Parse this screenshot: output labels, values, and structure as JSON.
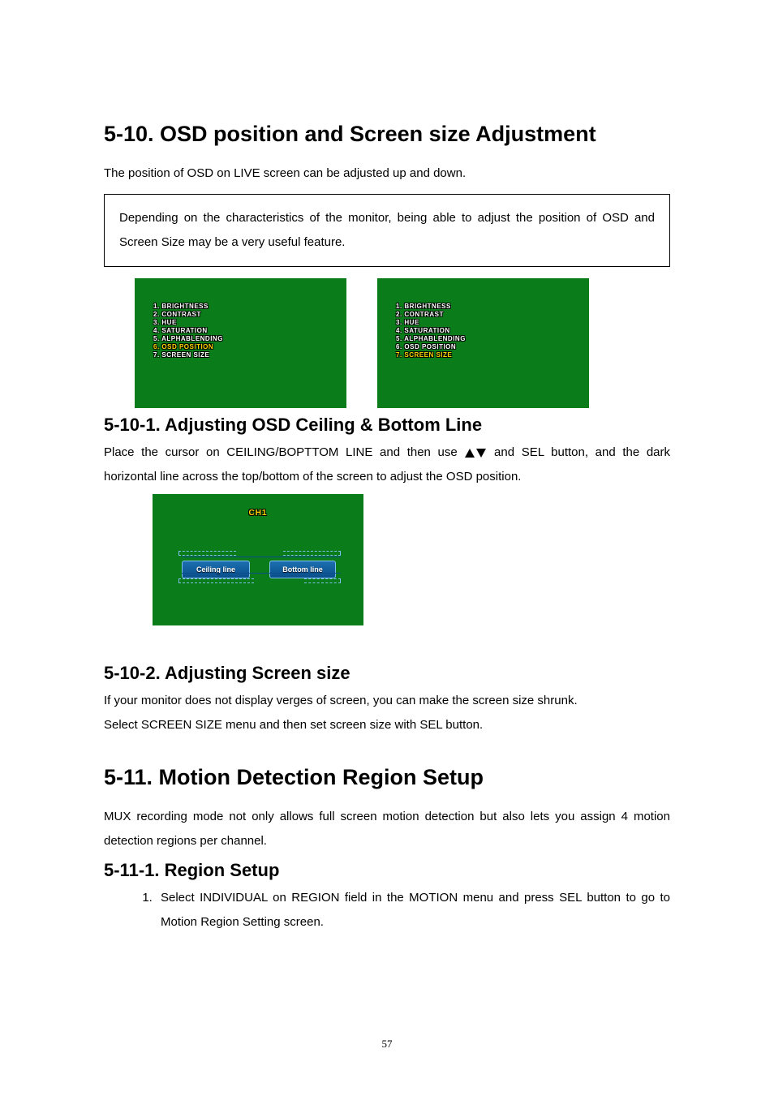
{
  "heading1": "5-10. OSD position and Screen size Adjustment",
  "intro1": "The position of OSD on LIVE screen can be adjusted up and down.",
  "note": "Depending on the characteristics of the monitor, being able to adjust the position of OSD and Screen Size may be a very useful feature.",
  "osd_menu": {
    "items": [
      "1. BRIGHTNESS",
      "2. CONTRAST",
      "3. HUE",
      "4. SATURATION",
      "5. ALPHABLENDING",
      "6. OSD POSITION",
      "7. SCREEN SIZE"
    ]
  },
  "section_10_1": {
    "title": "5-10-1. Adjusting OSD Ceiling & Bottom Line",
    "text_a": "Place the cursor on CEILING/BOPTTOM LINE and then use ",
    "text_b": " and SEL button, and the dark horizontal line across the top/bottom of the screen to adjust the OSD position."
  },
  "ch_screen": {
    "title": "CH1",
    "ceiling_label": "Ceiling line",
    "bottom_label": "Bottom line"
  },
  "section_10_2": {
    "title": "5-10-2. Adjusting Screen size",
    "line1": "If your monitor does not display verges of screen, you can make the screen size shrunk.",
    "line2": "Select SCREEN SIZE menu and then set screen size with SEL button."
  },
  "heading2": "5-11. Motion Detection Region Setup",
  "intro2": "MUX recording mode not only allows full screen motion detection but also lets you assign 4 motion detection regions per channel.",
  "section_11_1": {
    "title": "5-11-1. Region Setup",
    "step1": "Select INDIVIDUAL on REGION field in the MOTION menu and press SEL button to go to Motion Region Setting screen."
  },
  "page_number": "57"
}
